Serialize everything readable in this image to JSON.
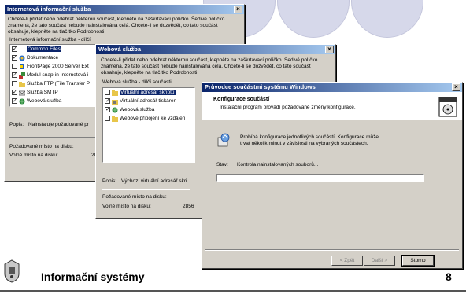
{
  "slide": {
    "title": "Informační systémy",
    "page_number": "8"
  },
  "win1": {
    "title": "Internetová informační služba",
    "close": "×",
    "description": "Chcete-li přidat nebo odebrat některou součást, klepněte na zaškrtávací políčko. Šedivé políčko znamená, že tato součást nebude nainstalována celá. Chcete-li se dozvědět, co tato součást obsahuje, klepněte na tlačítko Podrobnosti.",
    "list_label": "Internetová informační služba - dílčí",
    "items": [
      {
        "label": "Common Files",
        "checked": true,
        "icon": "diamond-icon"
      },
      {
        "label": "Dokumentace",
        "checked": true,
        "icon": "help-globe-icon"
      },
      {
        "label": "FrontPage 2000 Server Ext",
        "checked": false,
        "icon": "frontpage-icon"
      },
      {
        "label": "Modul snap-in Internetová i",
        "checked": true,
        "icon": "snapin-icon"
      },
      {
        "label": "Služba FTP (File Transfer P",
        "checked": false,
        "icon": "folder-icon"
      },
      {
        "label": "Služba SMTP",
        "checked": true,
        "icon": "mail-icon"
      },
      {
        "label": "Webová služba",
        "checked": true,
        "icon": "globe-icon"
      }
    ],
    "popis_label": "Popis:",
    "popis_value": "Nainstaluje požadované pr",
    "required_label": "Požadované místo na disku:",
    "free_label": "Volné místo na disku:",
    "free_value": "28"
  },
  "win2": {
    "title": "Webová služba",
    "close": "×",
    "description": "Chcete-li přidat nebo odebrat některou součást, klepněte na zaškrtávací políčko. Šedivé políčko znamená, že tato součást nebude nainstalována celá. Chcete-li se dozvědět, co tato součást obsahuje, klepněte na tlačítko Podrobnosti.",
    "list_label": "Webová služba - dílčí součásti",
    "items": [
      {
        "label": "Virtuální adresář skriptů",
        "checked": false,
        "selected": true,
        "icon": "folder-icon"
      },
      {
        "label": "Virtuální adresář tiskáren",
        "checked": true,
        "selected": false,
        "icon": "printer-folder-icon"
      },
      {
        "label": "Webová služba",
        "checked": true,
        "selected": false,
        "icon": "globe-icon"
      },
      {
        "label": "Webové připojení ke vzdálen",
        "checked": false,
        "selected": false,
        "icon": "folder-icon"
      }
    ],
    "popis_label": "Popis:",
    "popis_value": "Výchozí virtuální adresář skri",
    "required_label": "Požadované místo na disku:",
    "free_label": "Volné místo na disku:",
    "free_value": "2856"
  },
  "win3": {
    "title": "Průvodce součástmi systému Windows",
    "close": "×",
    "header_title": "Konfigurace součástí",
    "header_sub": "Instalační program provádí požadované změny konfigurace.",
    "body_text": "Probíhá konfigurace jednotlivých součástí. Konfigurace může trvat několik minut v závislosti na vybraných součástech.",
    "status_label": "Stav:",
    "status_value": "Kontrola nainstalovaných souborů...",
    "progress": 0.0,
    "buttons": {
      "back": "< Zpět",
      "next": "Další >",
      "cancel": "Storno"
    }
  }
}
